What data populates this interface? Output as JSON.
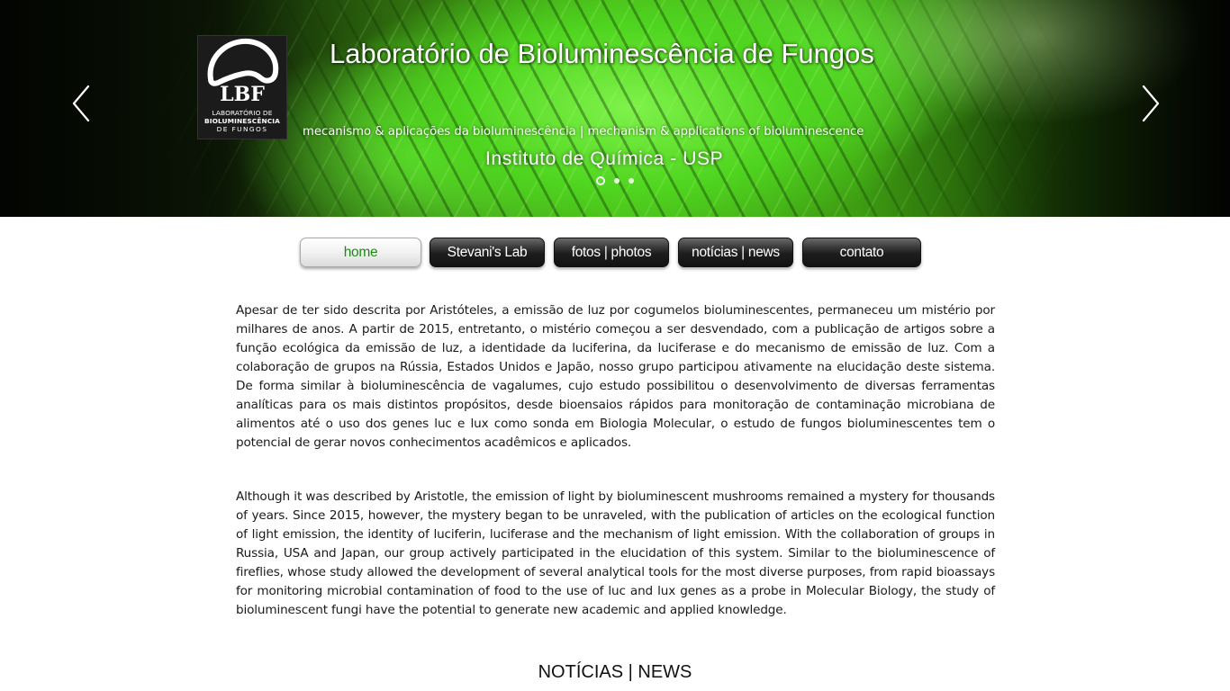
{
  "hero": {
    "title": "Laboratório de Bioluminescência de Fungos",
    "subtitle": "mecanismo & aplicações da bioluminescência | mechanism & applications of bioluminescence",
    "institute": "Instituto de Química - USP",
    "logo": {
      "mark": "LBF",
      "line1": "LABORATÓRIO DE",
      "line2": "BIOLUMINESCÊNCIA",
      "line3": "DE FUNGOS"
    },
    "slides": {
      "count": 3,
      "active": 1
    },
    "prev_icon": "chevron-left-icon",
    "next_icon": "chevron-right-icon"
  },
  "nav": {
    "items": [
      {
        "label": "home",
        "active": true
      },
      {
        "label": "Stevani's Lab",
        "active": false
      },
      {
        "label": "fotos | photos",
        "active": false
      },
      {
        "label": "notícias | news",
        "active": false
      },
      {
        "label": "contato",
        "active": false
      }
    ]
  },
  "content": {
    "paragraph_pt": "Apesar de ter sido descrita por Aristóteles, a emissão de luz por cogumelos bioluminescentes, permaneceu um mistério por milhares de anos. A partir de 2015, entretanto, o mistério começou a ser desvendado, com a publicação de artigos sobre a função ecológica da emissão de luz, a identidade da luciferina, da luciferase e do mecanismo de emissão de luz. Com a colaboração de grupos na Rússia, Estados Unidos e Japão, nosso grupo participou ativamente na elucidação deste sistema. De forma similar à bioluminescência de vagalumes, cujo estudo possibilitou o desenvolvimento de diversas ferramentas analíticas para os mais distintos propósitos, desde bioensaios rápidos para monitoração de contaminação microbiana de alimentos até o uso dos genes luc e lux como sonda em Biologia Molecular, o estudo de fungos bioluminescentes tem o potencial de gerar novos conhecimentos acadêmicos e aplicados.",
    "paragraph_en": "Although it was described by Aristotle, the emission of light by bioluminescent mushrooms remained a mystery for thousands of years. Since 2015, however, the mystery began to be unraveled, with the publication of articles on the ecological function of light emission, the identity of luciferin, luciferase and the mechanism of light emission. With the collaboration of groups in Russia, USA and Japan, our group actively participated in the elucidation of this system. Similar to the bioluminescence of fireflies, whose study allowed the development of several analytical tools for the most diverse purposes, from rapid bioassays for monitoring microbial contamination of food to the use of luc and lux genes as a probe in Molecular Biology, the study of bioluminescent fungi have the potential to generate new academic and applied knowledge.",
    "news_heading": "NOTÍCIAS | NEWS"
  },
  "colors": {
    "accent_green": "#1e8a16",
    "hero_glow": "#5fe02e",
    "nav_dark": "#1d1d1d",
    "text": "#1a1a1a"
  }
}
